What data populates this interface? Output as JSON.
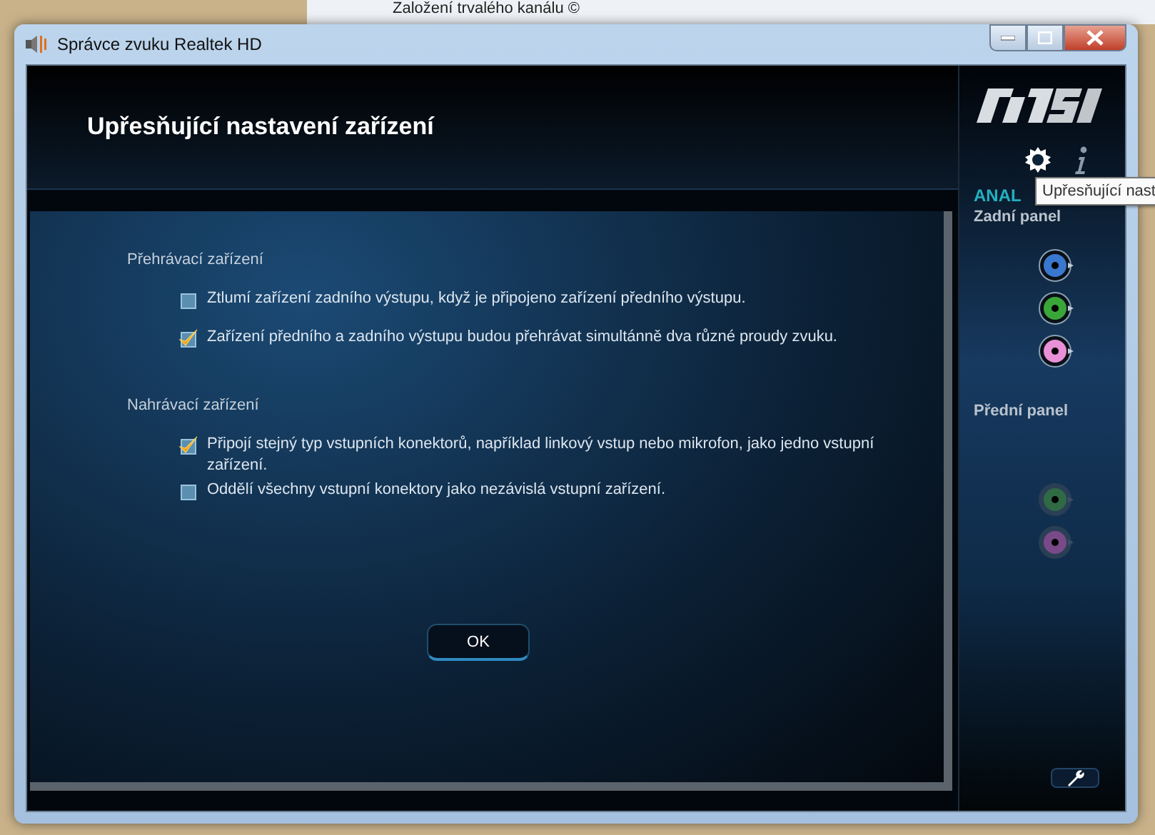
{
  "background_window": {
    "title": "Založení trvalého kanálu ©"
  },
  "window": {
    "title": "Správce zvuku Realtek HD"
  },
  "dialog": {
    "title": "Upřesňující nastavení zařízení",
    "sections": [
      {
        "heading": "Přehrávací zařízení",
        "options": [
          {
            "label": "Ztlumí zařízení zadního výstupu, když je připojeno zařízení předního výstupu.",
            "checked": false
          },
          {
            "label": "Zařízení předního a zadního výstupu budou přehrávat simultánně dva různé proudy zvuku.",
            "checked": true
          }
        ]
      },
      {
        "heading": "Nahrávací zařízení",
        "options": [
          {
            "label": "Připojí stejný typ vstupních konektorů, například linkový vstup nebo mikrofon, jako jedno vstupní zařízení.",
            "checked": true
          },
          {
            "label": "Oddělí všechny vstupní konektory jako nezávislá vstupní zařízení.",
            "checked": false
          }
        ]
      }
    ],
    "ok_button": "OK"
  },
  "sidebar": {
    "section_label": "ANAL",
    "tooltip": "Upřesňující nast",
    "panels": [
      {
        "title": "Zadní panel",
        "jacks": [
          {
            "color": "#3a78d0",
            "connected": true
          },
          {
            "color": "#3aa63a",
            "connected": true
          },
          {
            "color": "#e890d8",
            "connected": true
          }
        ]
      },
      {
        "title": "Přední panel",
        "jacks": [
          {
            "color": "#2f6a45",
            "connected": false
          },
          {
            "color": "#7a4a88",
            "connected": false
          }
        ]
      }
    ]
  }
}
